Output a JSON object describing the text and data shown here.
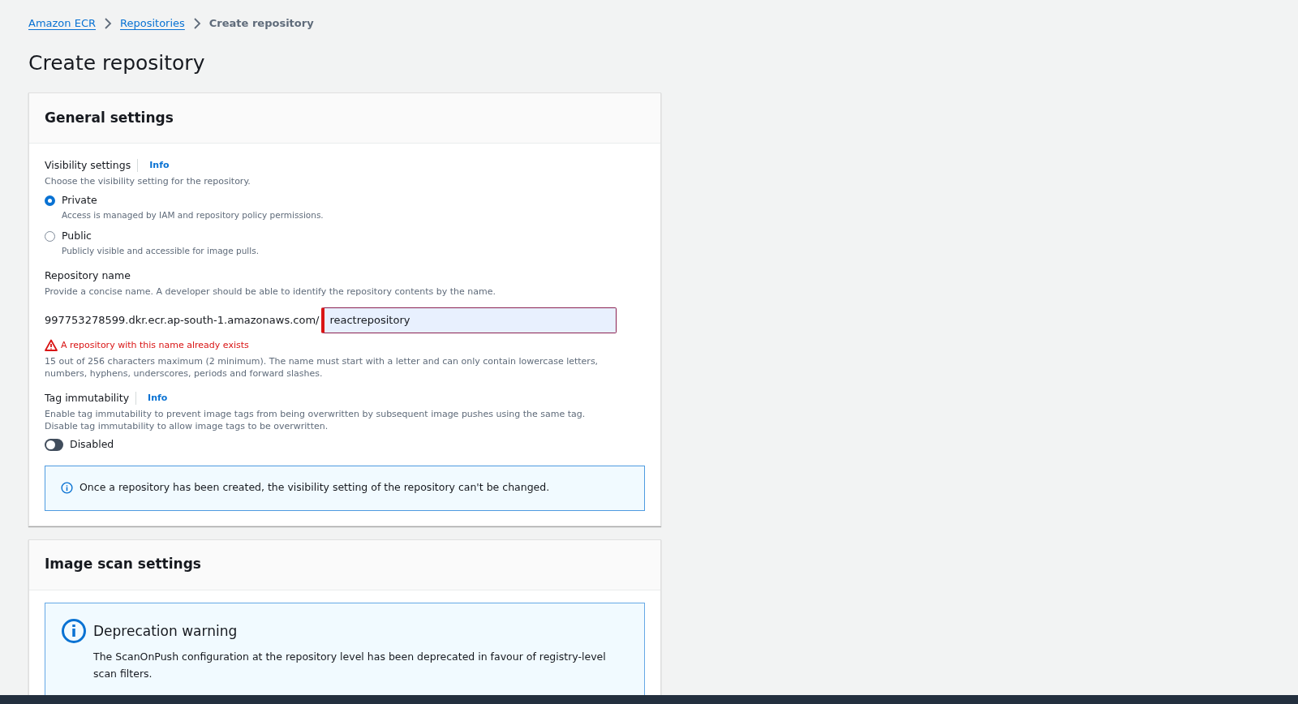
{
  "breadcrumbs": [
    {
      "label": "Amazon ECR",
      "kind": "link"
    },
    {
      "label": "Repositories",
      "kind": "link"
    },
    {
      "label": "Create repository",
      "kind": "current"
    }
  ],
  "page_title": "Create repository",
  "general_settings": {
    "title": "General settings",
    "visibility": {
      "label": "Visibility settings",
      "info": "Info",
      "description": "Choose the visibility setting for the repository.",
      "options": [
        {
          "label": "Private",
          "description": "Access is managed by IAM and repository policy permissions.",
          "selected": true
        },
        {
          "label": "Public",
          "description": "Publicly visible and accessible for image pulls.",
          "selected": false
        }
      ]
    },
    "repository_name": {
      "label": "Repository name",
      "description": "Provide a concise name. A developer should be able to identify the repository contents by the name.",
      "prefix": "997753278599.dkr.ecr.ap-south-1.amazonaws.com/",
      "value": "reactrepository",
      "error": "A repository with this name already exists",
      "constraint": "15 out of 256 characters maximum (2 minimum). The name must start with a letter and can only contain lowercase letters, numbers, hyphens, underscores, periods and forward slashes."
    },
    "tag_immutability": {
      "label": "Tag immutability",
      "info": "Info",
      "description": "Enable tag immutability to prevent image tags from being overwritten by subsequent image pushes using the same tag. Disable tag immutability to allow image tags to be overwritten.",
      "toggle": {
        "on": false,
        "label": "Disabled"
      }
    },
    "notice": "Once a repository has been created, the visibility setting of the repository can't be changed."
  },
  "image_scan_settings": {
    "title": "Image scan settings",
    "alert": {
      "title": "Deprecation warning",
      "message": "The ScanOnPush configuration at the repository level has been deprecated in favour of registry-level scan filters."
    }
  }
}
